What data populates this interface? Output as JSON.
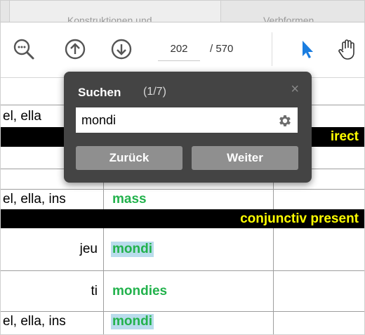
{
  "tabs": [
    "Konstruktionen und ...",
    "Verbformen..."
  ],
  "toolbar": {
    "zoom_icon": "zoom-out-icon",
    "page_current": "202",
    "page_total": "/ 570",
    "colors": {
      "accent": "#1a7de0"
    }
  },
  "table": {
    "row_top_pron": "",
    "row1_pron": "el, ella",
    "bar1_text": "irect",
    "row_after_bar1_pron": "",
    "row2_pron": "el, ella, ins",
    "row2_verb": "mass",
    "bar2_text": "conjunctiv present",
    "row3_pron": "jeu",
    "row3_verb": "mondi",
    "row4_pron": "ti",
    "row4_verb": "mondies",
    "row5_pron": "el, ella, ins",
    "row5_verb": "mondi",
    "colors": {
      "verb": "#22b24c",
      "highlight": "#b9dcec",
      "bar_text": "#ffff00"
    }
  },
  "search": {
    "title": "Suchen",
    "count": "(1/7)",
    "close": "×",
    "query": "mondi",
    "back_label": "Zurück",
    "next_label": "Weiter"
  }
}
